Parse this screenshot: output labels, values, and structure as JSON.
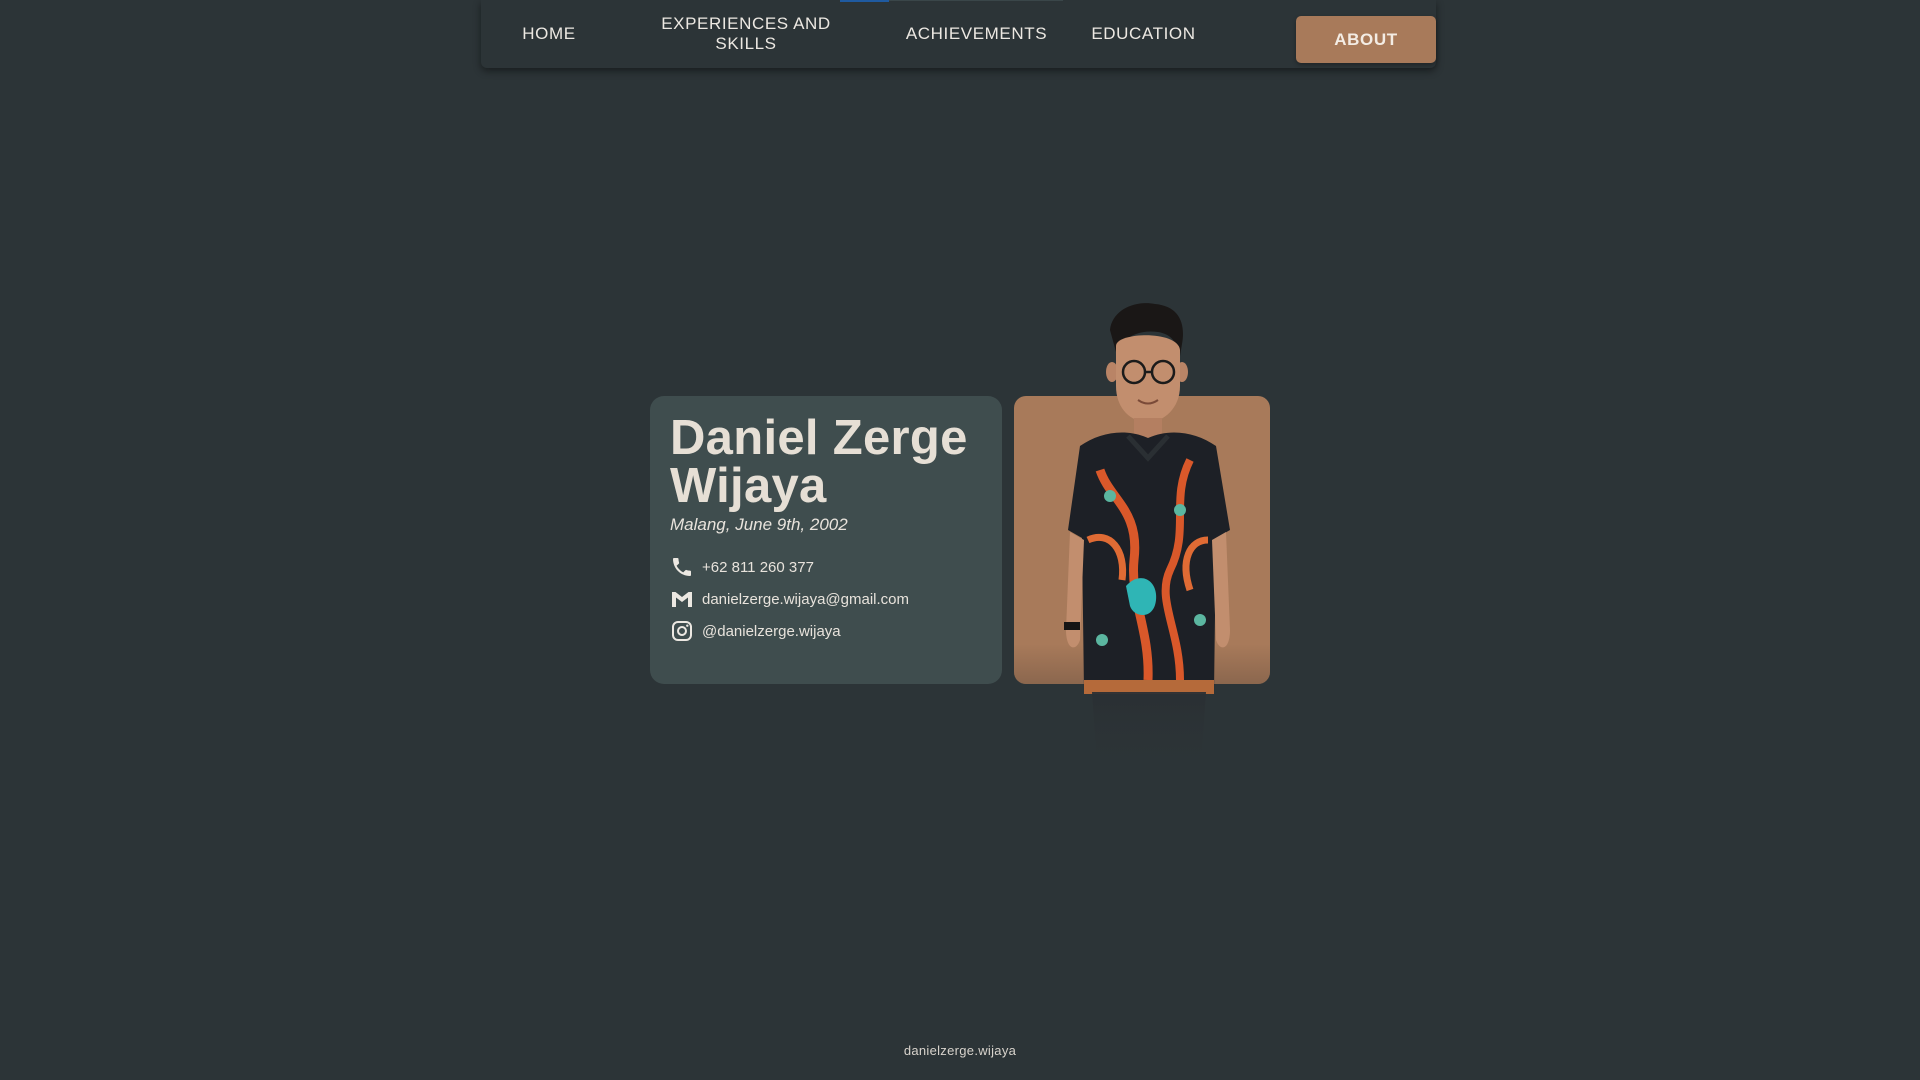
{
  "nav": {
    "items": [
      {
        "label": "HOME"
      },
      {
        "label": "EXPERIENCES AND SKILLS"
      },
      {
        "label": "ACHIEVEMENTS"
      },
      {
        "label": "EDUCATION"
      },
      {
        "label": "ABOUT"
      }
    ],
    "active": "ABOUT"
  },
  "profile": {
    "name": "Daniel Zerge Wijaya",
    "birth": "Malang, June 9th, 2002",
    "contacts": {
      "phone": "+62 811 260 377",
      "email": "danielzerge.wijaya@gmail.com",
      "instagram": "@danielzerge.wijaya"
    }
  },
  "footer": {
    "text": "danielzerge.wijaya"
  },
  "icons": {
    "phone": "phone-icon",
    "email": "gmail-icon",
    "instagram": "instagram-icon"
  },
  "colors": {
    "background": "#2c3437",
    "card": "#3f4d4e",
    "accent": "#a87a5a",
    "text": "#e8e3dc"
  }
}
